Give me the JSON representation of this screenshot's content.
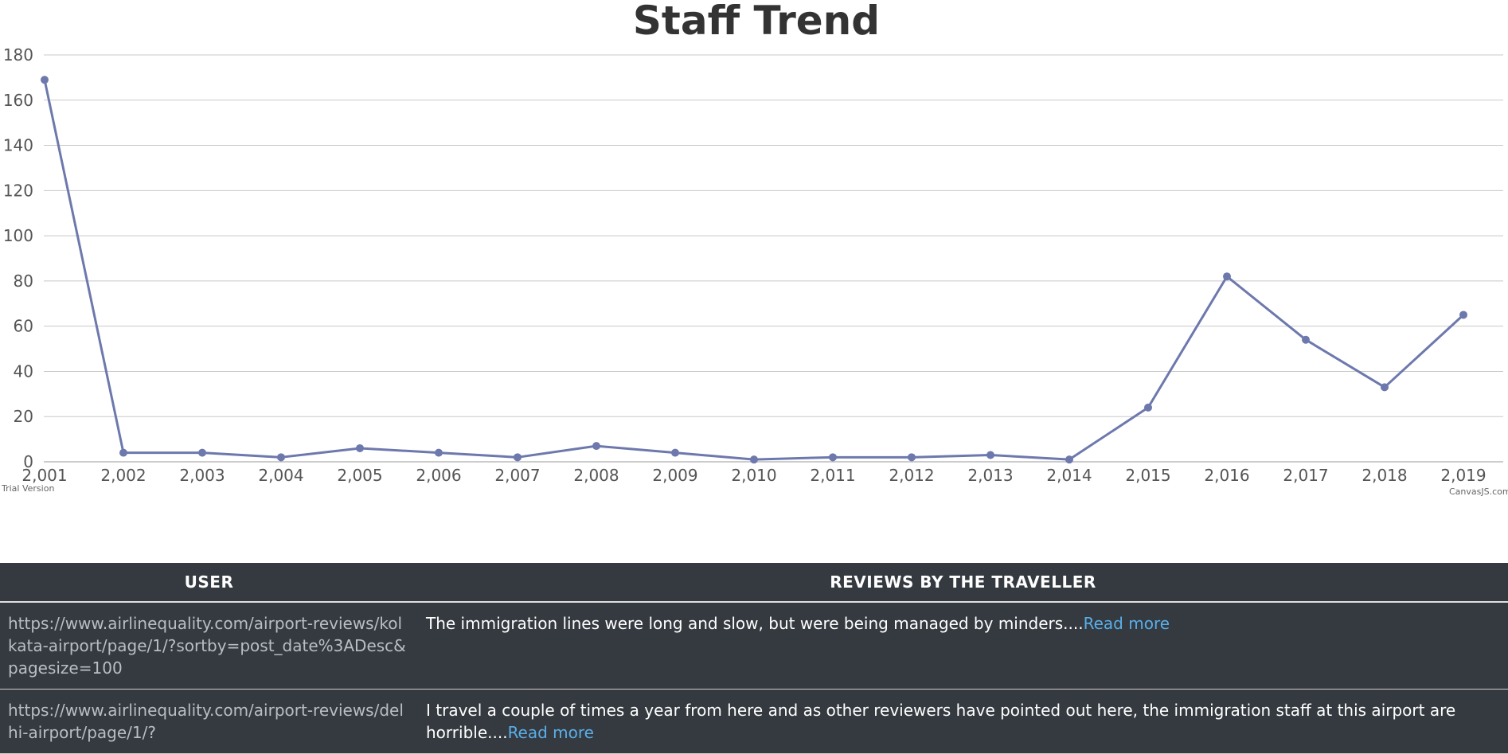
{
  "chart_data": {
    "type": "line",
    "title": "Staff Trend",
    "x": [
      "2,001",
      "2,002",
      "2,003",
      "2,004",
      "2,005",
      "2,006",
      "2,007",
      "2,008",
      "2,009",
      "2,010",
      "2,011",
      "2,012",
      "2,013",
      "2,014",
      "2,015",
      "2,016",
      "2,017",
      "2,018",
      "2,019"
    ],
    "series": [
      {
        "values": [
          169,
          4,
          4,
          2,
          6,
          4,
          2,
          7,
          4,
          1,
          2,
          2,
          3,
          1,
          24,
          82,
          54,
          33,
          65
        ]
      }
    ],
    "y_ticks": [
      "0",
      "20",
      "40",
      "60",
      "80",
      "100",
      "120",
      "140",
      "160",
      "180"
    ],
    "ylim": [
      0,
      180
    ],
    "grid": true,
    "color": "#6d78ad",
    "trial_label": "Trial Version",
    "credit_label": "CanvasJS.com"
  },
  "table": {
    "headers": {
      "user": "USER",
      "reviews": "REVIEWS BY THE TRAVELLER"
    },
    "rows": [
      {
        "user": "https://www.airlinequality.com/airport-reviews/kolkata-airport/page/1/?sortby=post_date%3ADesc&pagesize=100",
        "review": "The immigration lines were long and slow, but were being managed by minders....",
        "link": "Read more"
      },
      {
        "user": "https://www.airlinequality.com/airport-reviews/delhi-airport/page/1/?",
        "review": "I travel a couple of times a year from here and as other reviewers have pointed out here, the immigration staff at this airport are horrible....",
        "link": "Read more"
      }
    ]
  }
}
